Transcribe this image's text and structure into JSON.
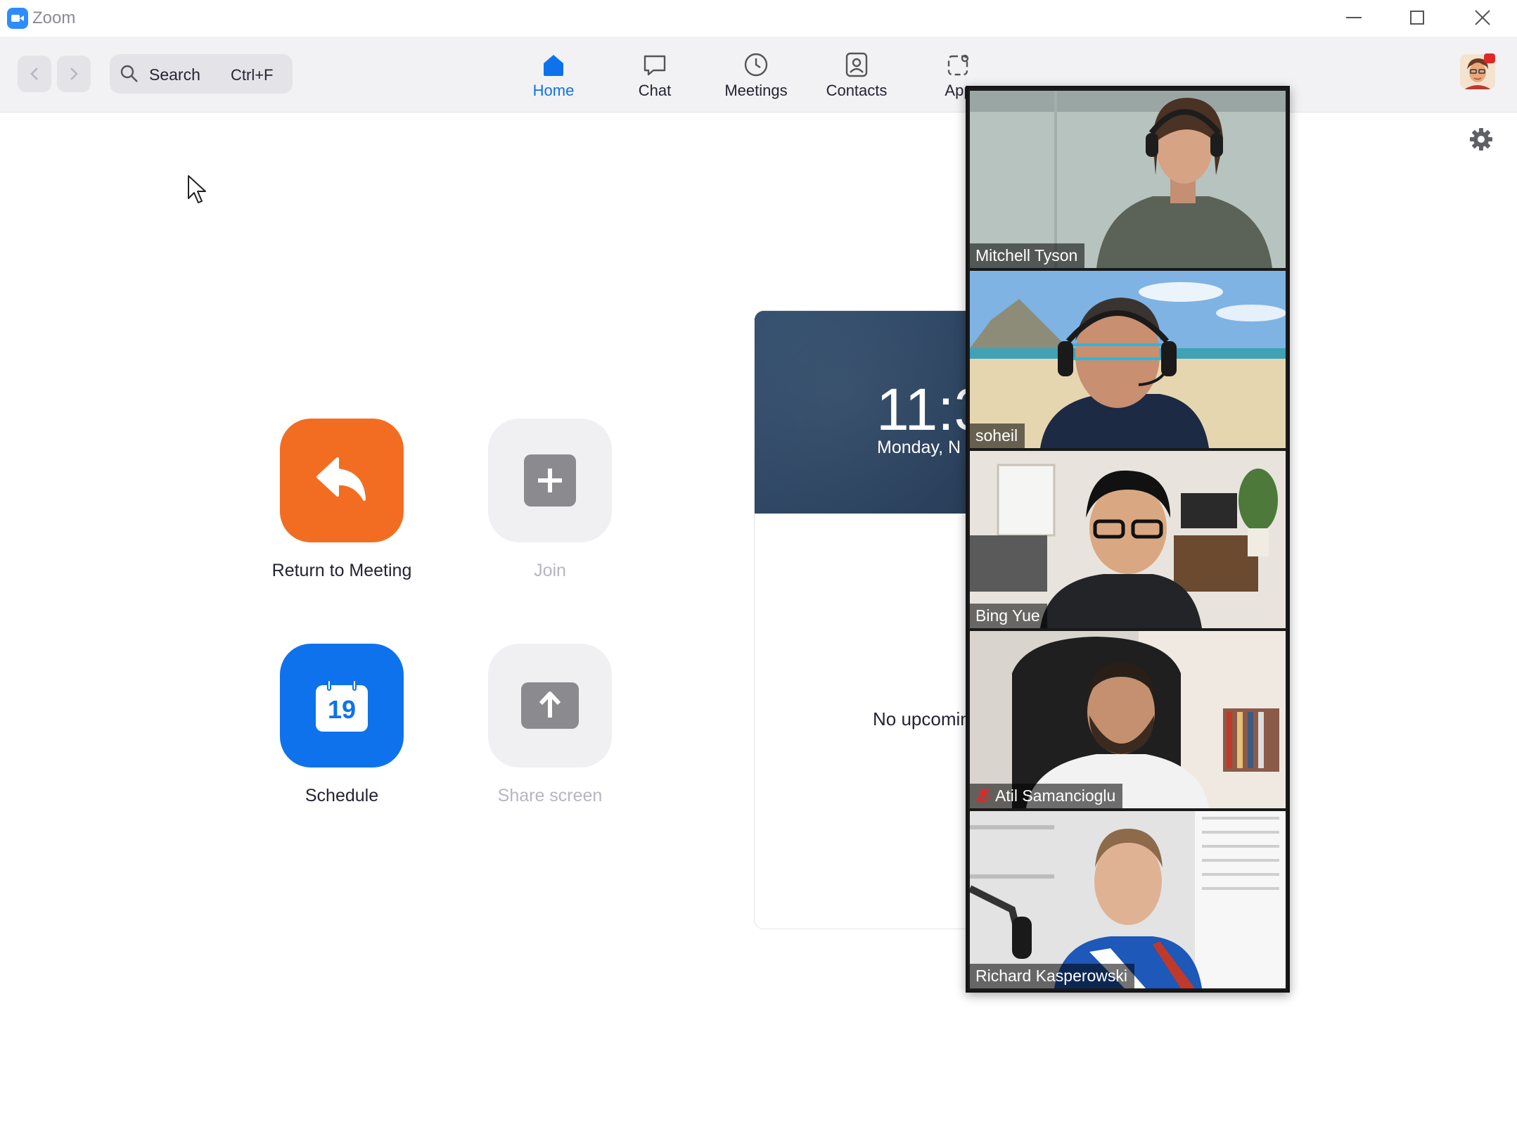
{
  "window": {
    "app_title": "Zoom",
    "controls": [
      "minimize-icon",
      "maximize-icon",
      "close-icon"
    ]
  },
  "nav": {
    "search_label": "Search",
    "search_shortcut": "Ctrl+F",
    "tabs": [
      {
        "label": "Home",
        "icon": "home-icon",
        "active": true
      },
      {
        "label": "Chat",
        "icon": "chat-bubble-icon",
        "active": false
      },
      {
        "label": "Meetings",
        "icon": "clock-icon",
        "active": false
      },
      {
        "label": "Contacts",
        "icon": "contact-card-icon",
        "active": false
      },
      {
        "label": "Apps",
        "icon": "apps-icon",
        "active": false
      }
    ],
    "visible_apps_label": "App",
    "active_color": "#0e72ed"
  },
  "home": {
    "actions": [
      {
        "label": "Return to Meeting",
        "icon": "return-arrow-icon",
        "color": "#f26d21",
        "enabled": true
      },
      {
        "label": "Join",
        "icon": "plus-icon",
        "color": "#f0f0f3",
        "enabled": false
      },
      {
        "label": "Schedule",
        "icon": "calendar-icon",
        "calendar_day": "19",
        "color": "#0e72ed",
        "enabled": true
      },
      {
        "label": "Share screen",
        "icon": "share-up-arrow-icon",
        "color": "#f0f0f3",
        "enabled": false
      }
    ]
  },
  "clock_card": {
    "time": "11:3",
    "date": "Monday, N",
    "empty_message": "No upcomin"
  },
  "video_panel": {
    "participants": [
      {
        "name": "Mitchell Tyson",
        "muted": false,
        "speaking": false
      },
      {
        "name": "soheil",
        "muted": false,
        "speaking": true
      },
      {
        "name": "Bing Yue",
        "muted": false,
        "speaking": false
      },
      {
        "name": "Atil Samancioglu",
        "muted": true,
        "speaking": false
      },
      {
        "name": "Richard Kasperowski",
        "muted": false,
        "speaking": false
      }
    ],
    "speaking_color": "#7bc043",
    "muted_color": "#e02828"
  }
}
